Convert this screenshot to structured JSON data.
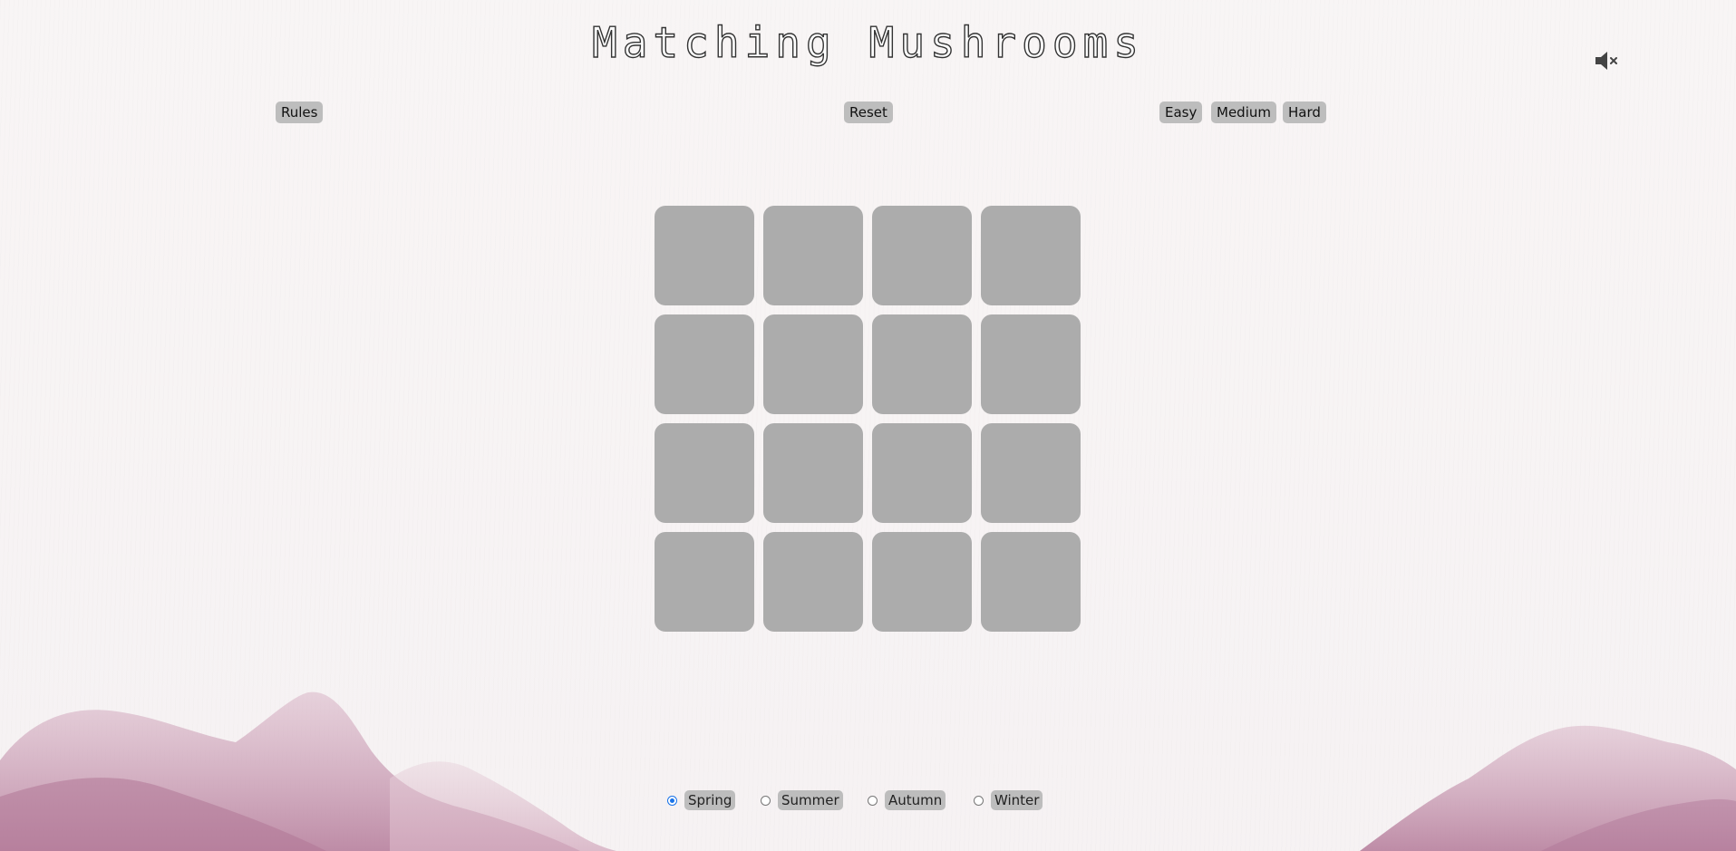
{
  "title": {
    "word1": "Matching",
    "word2": "Mushrooms"
  },
  "sound": {
    "icon": "speaker-muted-icon"
  },
  "controls": {
    "rules_label": "Rules",
    "reset_label": "Reset",
    "difficulty": [
      "Easy",
      "Medium",
      "Hard"
    ]
  },
  "board": {
    "rows": 4,
    "columns": 4,
    "face_down_color": "#acacac"
  },
  "seasons": {
    "options": [
      "Spring",
      "Summer",
      "Autumn",
      "Winter"
    ],
    "selected": "Spring",
    "radio_color": "#1a73e8"
  },
  "colors": {
    "background": "#f7f3f3",
    "mountain": "#c48aa8",
    "button": "#bdbdbd"
  }
}
